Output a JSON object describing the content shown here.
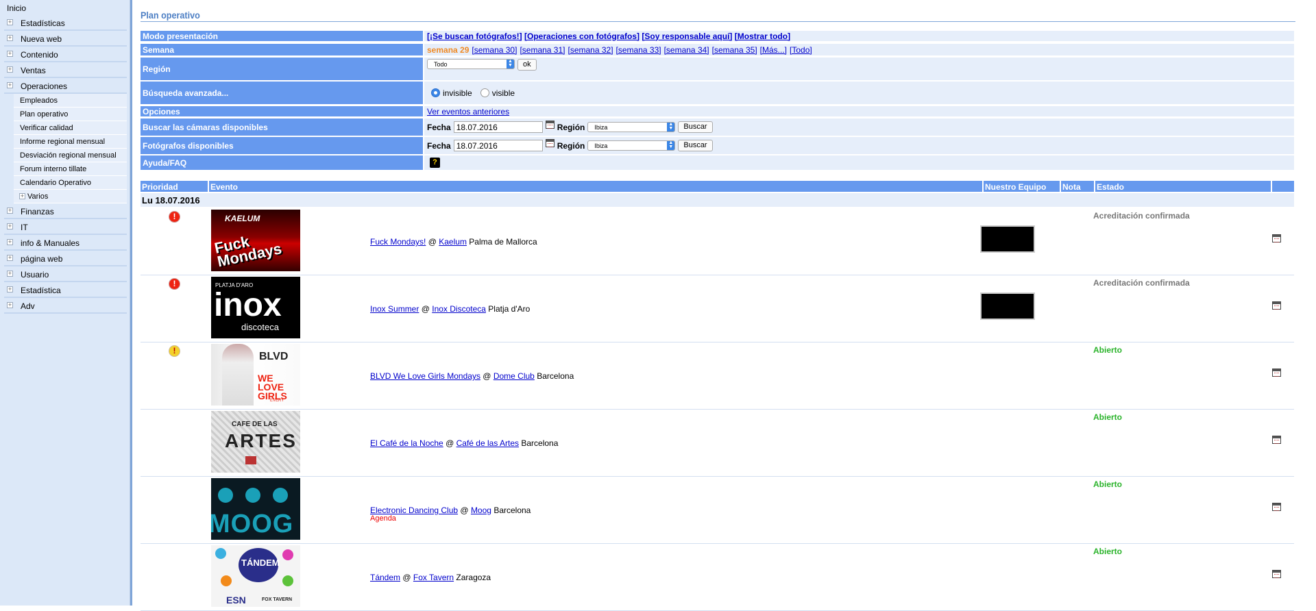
{
  "sidebar": {
    "top": "Inicio",
    "items_before": [
      "Estadísticas",
      "Nueva web",
      "Contenido",
      "Ventas",
      "Operaciones"
    ],
    "sub": [
      "Empleados",
      "Plan operativo",
      "Verificar calidad",
      "Informe regional mensual",
      "Desviación regional mensual",
      "Forum interno tillate",
      "Calendario Operativo"
    ],
    "sub_plus": "Varios",
    "items_after": [
      "Finanzas",
      "IT",
      "info & Manuales",
      "página web",
      "Usuario",
      "Estadística",
      "Adv"
    ]
  },
  "page": {
    "title": "Plan operativo"
  },
  "options": {
    "modo_label": "Modo presentación",
    "modo_links": [
      "[¡Se buscan fotógrafos!]",
      "[Operaciones con fotógrafos]",
      "[Soy responsable aquí]",
      "[Mostrar todo]"
    ],
    "semana_label": "Semana",
    "semana_current": "semana 29",
    "semana_links": [
      "[semana 30]",
      "[semana 31]",
      "[semana 32]",
      "[semana 33]",
      "[semana 34]",
      "[semana 35]",
      "[Más...]",
      "[Todo]"
    ],
    "region_label": "Región",
    "region_value": "Todo",
    "ok_label": "ok",
    "busqueda_label": "Búsqueda avanzada...",
    "radio_invisible": "invisible",
    "radio_visible": "visible",
    "opciones_label": "Opciones",
    "opciones_link": "Ver eventos anteriores",
    "camaras_label": "Buscar las cámaras disponibles",
    "fotografos_label": "Fotógrafos disponibles",
    "fecha_label": "Fecha",
    "fecha_value": "18.07.2016",
    "region2_label": "Región",
    "region2_value": "Ibiza",
    "buscar_label": "Buscar",
    "ayuda_label": "Ayuda/FAQ",
    "ayuda_icon": "?"
  },
  "table": {
    "headers": [
      "Prioridad",
      "Evento",
      "Nuestro Equipo",
      "Nota",
      "Estado"
    ],
    "date": "Lu 18.07.2016",
    "events": [
      {
        "name": "Fuck Mondays!",
        "venue": "Kaelum",
        "city": "Palma de Mallorca",
        "status": "Acreditación confirmada",
        "prio": "red",
        "thumb_text": "Fuck Mondays",
        "thumb_top": "KAELUM"
      },
      {
        "name": "Inox Summer",
        "venue": "Inox Discoteca",
        "city": "Platja d'Aro",
        "status": "Acreditación confirmada",
        "prio": "red",
        "thumb_text": "inox",
        "thumb_top": "PLATJA D'ARO",
        "thumb_sub": "discoteca"
      },
      {
        "name": "BLVD We Love Girls Mondays",
        "venue": "Dome Club",
        "city": "Barcelona",
        "status": "Abierto",
        "prio": "yellow",
        "thumb_text": "WE LOVE GIRLS",
        "thumb_top": "BLVD",
        "thumb_sub": "EVERY"
      },
      {
        "name": "El Café de la Noche",
        "venue": "Café de las Artes",
        "city": "Barcelona",
        "status": "Abierto",
        "prio": "",
        "thumb_text": "ARTES",
        "thumb_top": "CAFE DE LAS"
      },
      {
        "name": "Electronic Dancing Club",
        "venue": "Moog",
        "city": "Barcelona",
        "status": "Abierto",
        "prio": "",
        "agenda": "Agenda",
        "thumb_text": "MOOG"
      },
      {
        "name": "Tándem",
        "venue": "Fox Tavern",
        "city": "Zaragoza",
        "status": "Abierto",
        "prio": "",
        "thumb_text": "TÁNDEM",
        "thumb_sub": "ESN",
        "thumb_top": "FOX TAVERN"
      }
    ],
    "at": "@",
    "prio_symbol": "!"
  }
}
